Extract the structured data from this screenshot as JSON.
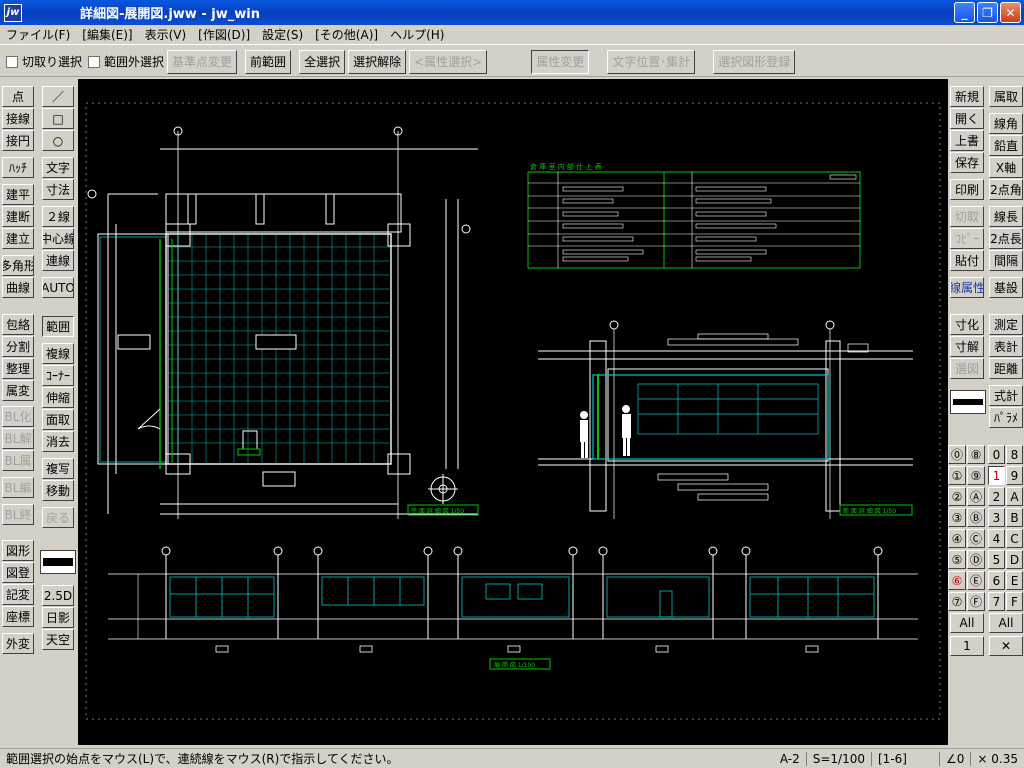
{
  "window": {
    "icon_text": "jw",
    "title": "詳細図-展開図.jww - jw_win",
    "min_glyph": "_",
    "max_glyph": "❐",
    "close_glyph": "✕"
  },
  "menu": [
    "ファイル(F)",
    "[編集(E)]",
    "表示(V)",
    "[作図(D)]",
    "設定(S)",
    "[その他(A)]",
    "ヘルプ(H)"
  ],
  "toolbar": {
    "check1": "切取り選択",
    "check2": "範囲外選択",
    "btn_base": "基準点変更",
    "btn_prev": "前範囲",
    "btn_all": "全選択",
    "btn_clear": "選択解除",
    "btn_attr_sel": "<属性選択>",
    "btn_attr_chg": "属性変更",
    "btn_text_pos": "文字位置･集計",
    "btn_reg": "選択図形登録"
  },
  "left_tools": {
    "col1": [
      "点",
      "接線",
      "接円",
      "ﾊｯﾁ",
      "建平",
      "建断",
      "建立",
      "多角形",
      "曲線",
      "包絡",
      "分割",
      "整理",
      "属変",
      "BL化",
      "BL解",
      "BL属",
      "BL編",
      "BL終",
      "図形",
      "図登",
      "記変",
      "座標",
      "外変"
    ],
    "col2": [
      "／",
      "□",
      "○",
      "文字",
      "寸法",
      "２線",
      "中心線",
      "連線",
      "AUTO",
      "範囲",
      "複線",
      "ｺｰﾅｰ",
      "伸縮",
      "面取",
      "消去",
      "複写",
      "移動",
      "戻る",
      "2.5D",
      "日影",
      "天空"
    ]
  },
  "right_tools": {
    "col1": [
      "新規",
      "開く",
      "上書",
      "保存",
      "印刷",
      "切取",
      "ｺﾋﾟｰ",
      "貼付",
      "線属性",
      "寸化",
      "寸解",
      "選図",
      "式計",
      "ﾊﾟﾗﾒ"
    ],
    "col2": [
      "属取",
      "線角",
      "鉛直",
      "X軸",
      "2点角",
      "線長",
      "2点長",
      "間隔",
      "基設",
      "測定",
      "表計",
      "距離"
    ]
  },
  "layers": {
    "groups": [
      "⓪",
      "①",
      "②",
      "③",
      "④",
      "⑤",
      "⑥",
      "⑦"
    ],
    "groups2": [
      "⑧",
      "⑨",
      "Ⓐ",
      "Ⓑ",
      "Ⓒ",
      "Ⓓ",
      "Ⓔ",
      "Ⓕ"
    ],
    "layers": [
      "0",
      "1",
      "2",
      "3",
      "4",
      "5",
      "6",
      "7"
    ],
    "layers2": [
      "8",
      "9",
      "A",
      "B",
      "C",
      "D",
      "E",
      "F"
    ],
    "all_label": "All",
    "group_current": "1",
    "close_glyph": "✕"
  },
  "drawing": {
    "table_title": "倉 庫 室   内 部 仕 上 表",
    "label_plan": "平 面 詳 細 図   1/50",
    "label_section": "断 面 詳 細 図   1/50",
    "label_elev": "展 開 図   1/100"
  },
  "status": {
    "message": "範囲選択の始点をマウス(L)で、連続線をマウス(R)で指示してください。",
    "paper": "A-2",
    "scale": "S=1/100",
    "layer": "[1-6]",
    "angle": "∠0",
    "factor": "× 0.35"
  },
  "colors": {
    "canvas_bg": "#000000",
    "line_white": "#ffffff",
    "line_cyan": "#00e5e5",
    "line_green": "#00c800",
    "line_magenta": "#ff00ff",
    "titlebar": "#0a4fd0"
  }
}
